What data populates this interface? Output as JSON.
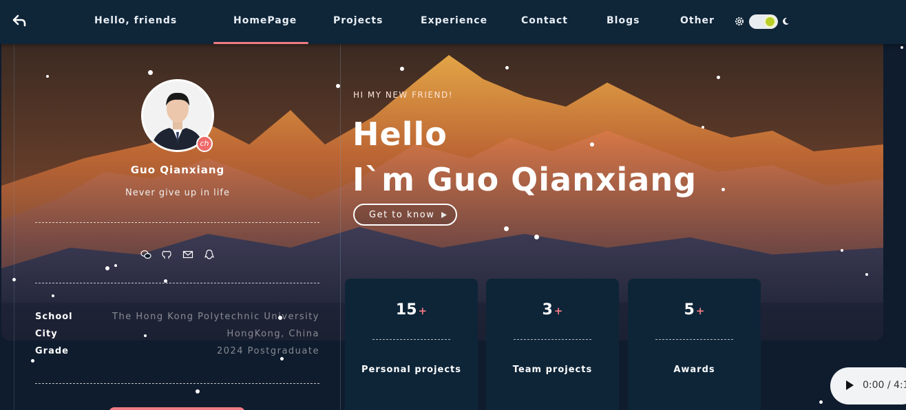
{
  "nav": {
    "greeting": "Hello, friends",
    "items": [
      {
        "label": "HomePage",
        "active": true
      },
      {
        "label": "Projects"
      },
      {
        "label": "Experience"
      },
      {
        "label": "Contact"
      },
      {
        "label": "Blogs"
      },
      {
        "label": "Other"
      }
    ],
    "icons": [
      "back-arrow-icon",
      "gear-icon",
      "theme-toggle",
      "moon-icon"
    ],
    "theme_toggle_on": true,
    "accent_color": "#ef7b83"
  },
  "profile": {
    "badge": "ch",
    "name": "Guo Qianxiang",
    "motto": "Never give up in life",
    "social_icons": [
      "wechat-icon",
      "github-icon",
      "mail-icon",
      "qq-icon"
    ],
    "info": [
      {
        "label": "School",
        "value": "The Hong Kong Polytechnic University"
      },
      {
        "label": "City",
        "value": "HongKong, China"
      },
      {
        "label": "Grade",
        "value": "2024 Postgraduate"
      }
    ]
  },
  "hero": {
    "kicker": "HI MY NEW FRIEND!",
    "title_line1": "Hello",
    "title_line2": "I`m Guo Qianxiang",
    "cta_label": "Get to know"
  },
  "stats": [
    {
      "value": "15",
      "suffix": "+",
      "label": "Personal projects"
    },
    {
      "value": "3",
      "suffix": "+",
      "label": "Team projects"
    },
    {
      "value": "5",
      "suffix": "+",
      "label": "Awards"
    }
  ],
  "audio": {
    "time": "0:00 / 4:1"
  }
}
